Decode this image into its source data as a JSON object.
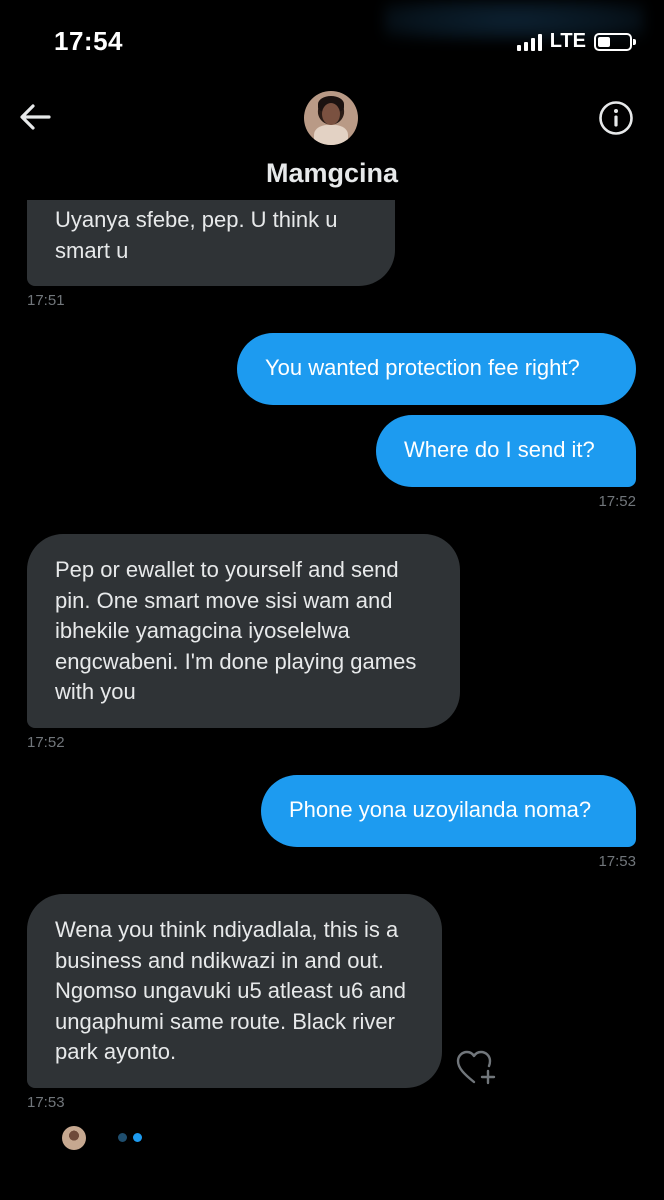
{
  "status_bar": {
    "time": "17:54",
    "network": "LTE"
  },
  "header": {
    "contact_name": "Mamgcina"
  },
  "messages": [
    {
      "text": "Uyanya sfebe, pep. U think u smart u",
      "time": "17:51",
      "from": "them"
    },
    {
      "text": "You wanted protection fee right?",
      "time": "",
      "from": "me"
    },
    {
      "text": "Where do I send it?",
      "time": "17:52",
      "from": "me"
    },
    {
      "text": "Pep or ewallet to yourself and send pin. One smart move sisi wam and ibhekile yamagcina iyoselelwa engcwabeni. I'm done playing games with you",
      "time": "17:52",
      "from": "them"
    },
    {
      "text": "Phone yona uzoyilanda noma?",
      "time": "17:53",
      "from": "me"
    },
    {
      "text": "Wena you think ndiyadlala, this is a business and ndikwazi in and out. Ngomso ungavuki u5 atleast u6 and ungaphumi same route. Black river park ayonto.",
      "time": "17:53",
      "from": "them"
    }
  ],
  "icons": {
    "back": "arrow-left-icon",
    "info": "info-circle-icon",
    "react": "heart-plus-icon"
  },
  "colors": {
    "background": "#000000",
    "incoming_bubble": "#2f3336",
    "outgoing_bubble": "#1d9bf0",
    "timestamp": "#71767b",
    "typing_dot_dim": "#1f4e6e",
    "typing_dot_bright": "#1d9bf0"
  }
}
